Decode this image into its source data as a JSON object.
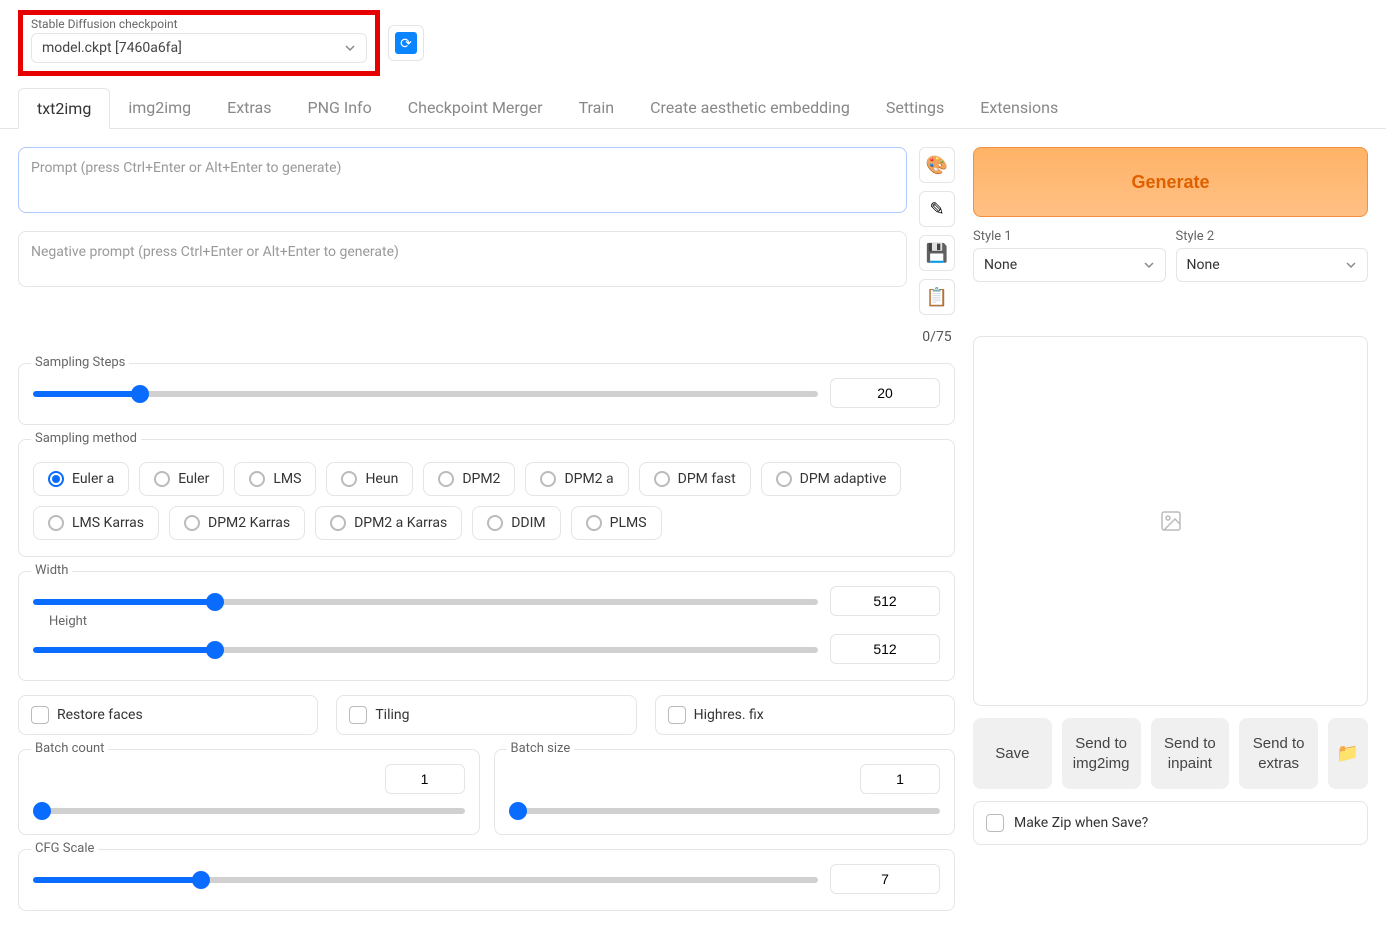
{
  "checkpoint": {
    "label": "Stable Diffusion checkpoint",
    "value": "model.ckpt [7460a6fa]"
  },
  "tabs": [
    "txt2img",
    "img2img",
    "Extras",
    "PNG Info",
    "Checkpoint Merger",
    "Train",
    "Create aesthetic embedding",
    "Settings",
    "Extensions"
  ],
  "active_tab": 0,
  "prompt": {
    "placeholder": "Prompt (press Ctrl+Enter or Alt+Enter to generate)",
    "value": ""
  },
  "neg_prompt": {
    "placeholder": "Negative prompt (press Ctrl+Enter or Alt+Enter to generate)",
    "value": ""
  },
  "token_count": "0/75",
  "generate_label": "Generate",
  "styles": {
    "s1": {
      "label": "Style 1",
      "value": "None"
    },
    "s2": {
      "label": "Style 2",
      "value": "None"
    }
  },
  "sampling_steps": {
    "label": "Sampling Steps",
    "value": 20,
    "min": 1,
    "max": 150
  },
  "sampling_method": {
    "label": "Sampling method",
    "selected": "Euler a",
    "options": [
      "Euler a",
      "Euler",
      "LMS",
      "Heun",
      "DPM2",
      "DPM2 a",
      "DPM fast",
      "DPM adaptive",
      "LMS Karras",
      "DPM2 Karras",
      "DPM2 a Karras",
      "DDIM",
      "PLMS"
    ]
  },
  "width": {
    "label": "Width",
    "value": 512,
    "min": 64,
    "max": 2048
  },
  "height": {
    "label": "Height",
    "value": 512,
    "min": 64,
    "max": 2048
  },
  "checks": {
    "restore_faces": "Restore faces",
    "tiling": "Tiling",
    "highres": "Highres. fix"
  },
  "batch_count": {
    "label": "Batch count",
    "value": 1,
    "min": 1,
    "max": 100
  },
  "batch_size": {
    "label": "Batch size",
    "value": 1,
    "min": 1,
    "max": 8
  },
  "cfg_scale": {
    "label": "CFG Scale",
    "value": 7,
    "min": 1,
    "max": 30
  },
  "actions": {
    "save": "Save",
    "img2img": "Send to img2img",
    "inpaint": "Send to inpaint",
    "extras": "Send to extras"
  },
  "zip_label": "Make Zip when Save?"
}
